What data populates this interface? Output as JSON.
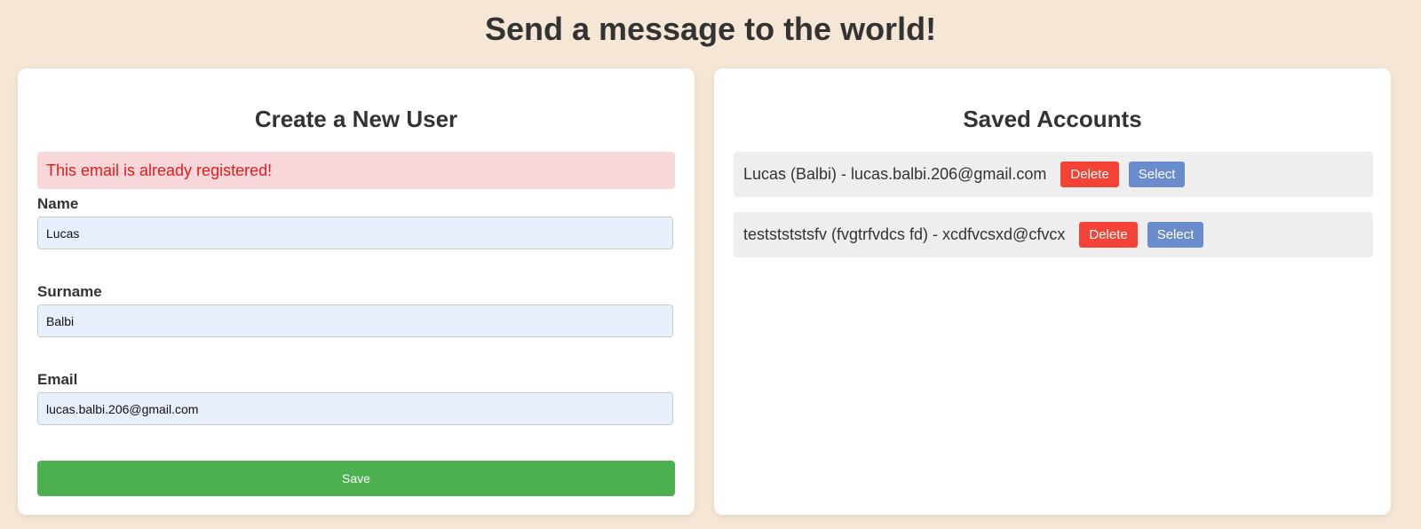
{
  "page": {
    "title": "Send a message to the world!"
  },
  "create_user": {
    "heading": "Create a New User",
    "error_message": "This email is already registered!",
    "fields": {
      "name": {
        "label": "Name",
        "value": "Lucas"
      },
      "surname": {
        "label": "Surname",
        "value": "Balbi"
      },
      "email": {
        "label": "Email",
        "value": "lucas.balbi.206@gmail.com"
      }
    },
    "save_label": "Save"
  },
  "saved_accounts": {
    "heading": "Saved Accounts",
    "items": [
      {
        "text": "Lucas (Balbi) - lucas.balbi.206@gmail.com",
        "delete_label": "Delete",
        "select_label": "Select"
      },
      {
        "text": "teststststsfv (fvgtrfvdcs fd) - xcdfvcsxd@cfvcx",
        "delete_label": "Delete",
        "select_label": "Select"
      }
    ]
  },
  "colors": {
    "background": "#f5e6d6",
    "error_bg": "#f8d7da",
    "error_text": "#e31b1b",
    "save_button": "#4caf50",
    "delete_button": "#f44336",
    "select_button": "#6a8bcc"
  }
}
